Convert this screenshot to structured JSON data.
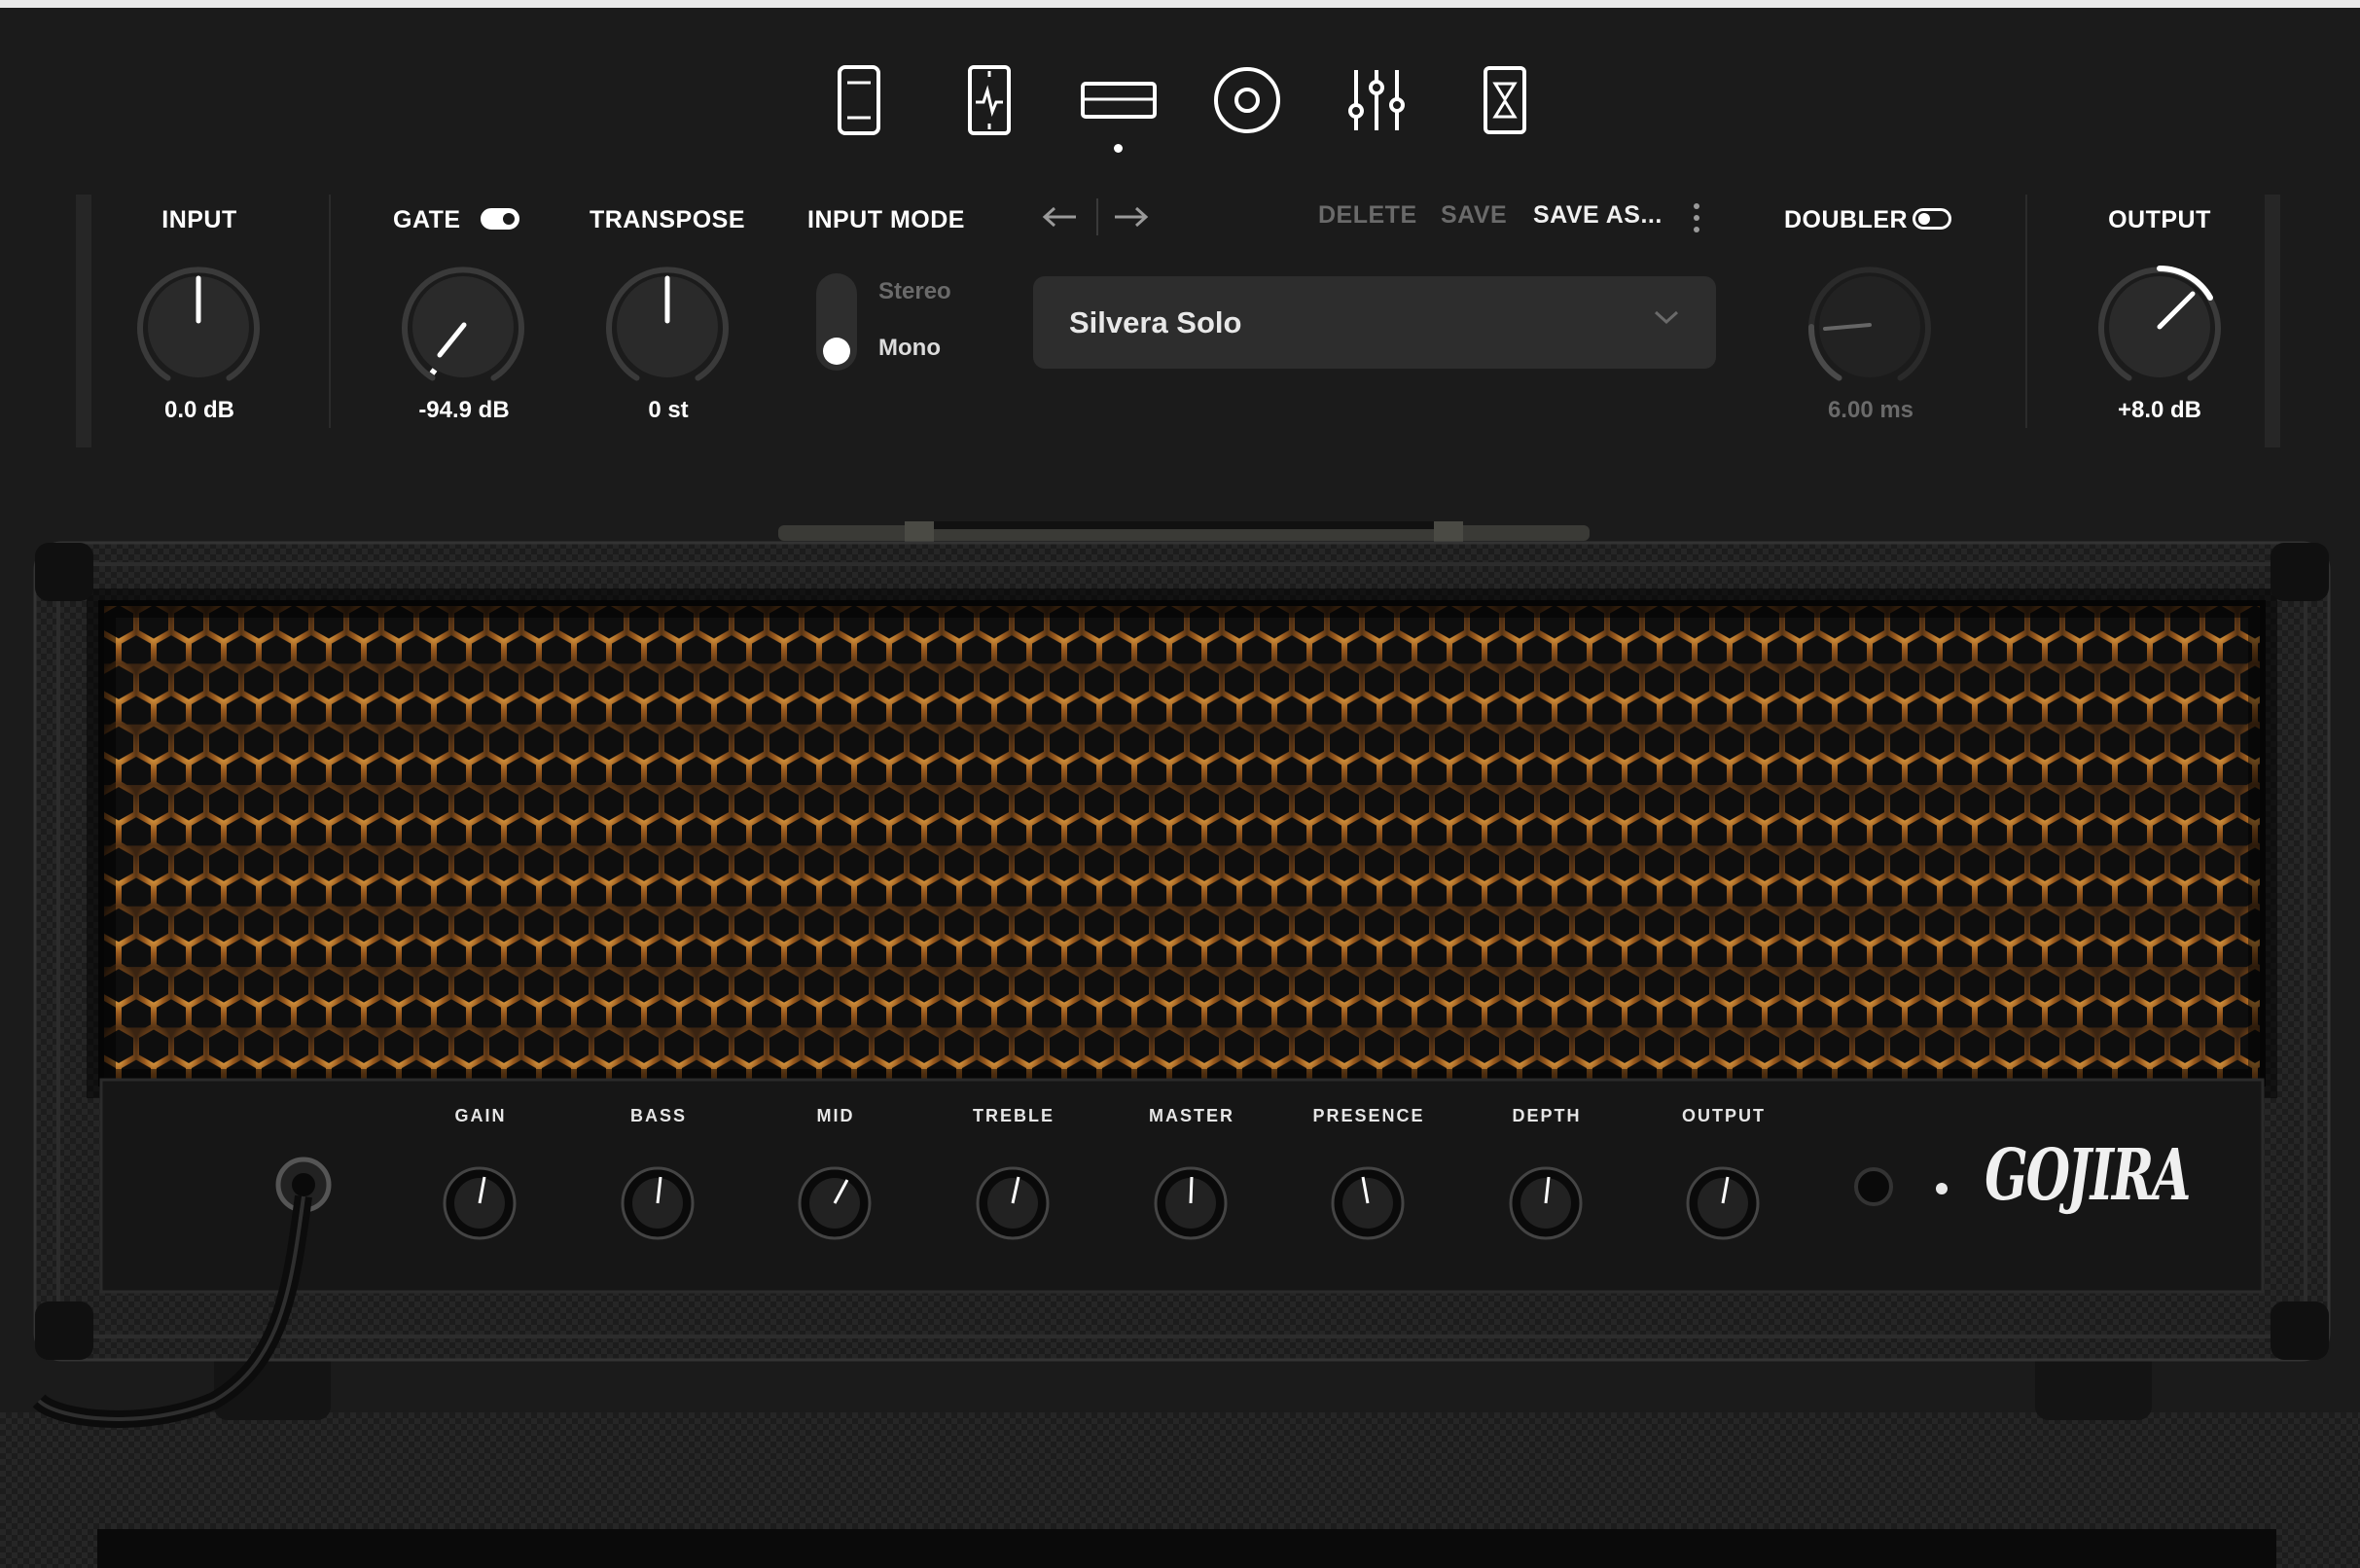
{
  "nav": {
    "items": [
      {
        "id": "pedal",
        "icon": "pedal-icon"
      },
      {
        "id": "pedal-fx",
        "icon": "pedal-fx-icon"
      },
      {
        "id": "amp",
        "icon": "amp-head-icon",
        "active": true
      },
      {
        "id": "cab",
        "icon": "speaker-icon"
      },
      {
        "id": "eq",
        "icon": "sliders-icon"
      },
      {
        "id": "rack",
        "icon": "rack-icon"
      }
    ]
  },
  "controls": {
    "input": {
      "label": "INPUT",
      "value": "0.0 dB"
    },
    "gate": {
      "label": "GATE",
      "value": "-94.9 dB",
      "enabled": true
    },
    "transpose": {
      "label": "TRANSPOSE",
      "value": "0 st"
    },
    "input_mode": {
      "label": "INPUT MODE",
      "options": [
        "Stereo",
        "Mono"
      ],
      "selected": "Mono"
    },
    "doubler": {
      "label": "DOUBLER",
      "value": "6.00 ms",
      "enabled": false
    },
    "output": {
      "label": "OUTPUT",
      "value": "+8.0 dB"
    }
  },
  "preset": {
    "delete_label": "DELETE",
    "save_label": "SAVE",
    "save_as_label": "SAVE AS...",
    "name": "Silvera Solo"
  },
  "amp": {
    "knobs": [
      "GAIN",
      "BASS",
      "MID",
      "TREBLE",
      "MASTER",
      "PRESENCE",
      "DEPTH",
      "OUTPUT"
    ],
    "logo": "GOJIRA"
  },
  "colors": {
    "background": "#1b1b1b",
    "accent": "#ffffff",
    "grille_glow": "#c8862e"
  }
}
